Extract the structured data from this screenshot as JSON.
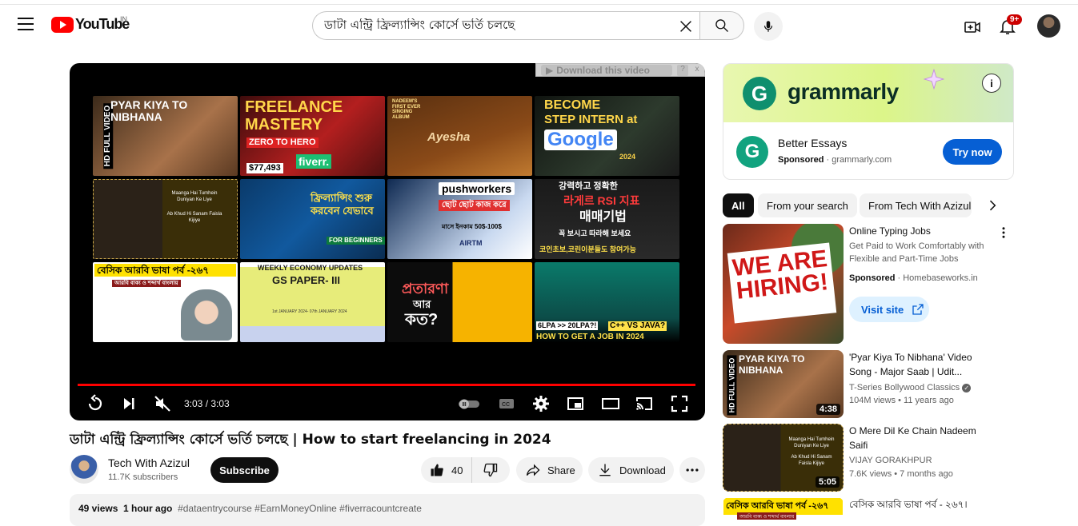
{
  "header": {
    "logo_text": "YouTube",
    "country": "IN",
    "search_value": "ডাটা এন্ট্রি ফ্রিল্যান্সিং কোর্সে ভর্তি চলছে",
    "notification_count": "9+"
  },
  "player": {
    "download_label": "Download this video",
    "download_help": "?",
    "download_close": "x",
    "time": "3:03 / 3:03",
    "end_screen": [
      {
        "line1": "PYAR KIYA TO",
        "line2": "NIBHANA",
        "side": "HD FULL VIDEO"
      },
      {
        "line1": "FREELANCE",
        "line2": "MASTERY",
        "line3": "ZERO TO HERO",
        "line4": "$77,493",
        "line5": "fiverr."
      },
      {
        "line1": "NADEEM'S FIRST EVER SINGING ALBUM",
        "line2": "Ayesha"
      },
      {
        "line1": "BECOME",
        "line2": "STEP INTERN at",
        "line3": "Google",
        "line4": "2024"
      },
      {
        "line1": "Maanga Hai Tumhein Duniyan Ke Liye",
        "line2": "Ab Khud Hi Sanam Faisla Kijiye"
      },
      {
        "line1": "ফ্রিল্যান্সিং শুরু করবেন যেভাবে",
        "line2": "FOR BEGINNERS"
      },
      {
        "line1": "pushworkers",
        "line2": "ছোট ছোট কাজ করে",
        "line3": "মাসে ইনকাম 50$-100$",
        "line4": "AIRTM"
      },
      {
        "line1": "강력하고 정확한",
        "line2": "라게르 RSI 지표",
        "line3": "매매기법",
        "line4": "꼭 보시고 따라해 보세요",
        "line5": "코인초보,코린이분들도 참여가능"
      },
      {
        "line1": "বেসিক আরবি ভাষা পর্ব -২৬৭",
        "line2": "আরবি বাক্য ও শব্দার্থ বাংলায়"
      },
      {
        "line1": "WEEKLY ECONOMY UPDATES",
        "line2": "GS PAPER- III",
        "line3": "1st JANUARY 2024- 07th JANUARY 2024"
      },
      {
        "line1": "প্রতারণা",
        "line2": "আর",
        "line3": "কত?"
      },
      {
        "line1": "6LPA >> 20LPA?!",
        "line2": "C++ VS JAVA?",
        "line3": "HOW TO GET A JOB IN 2024"
      }
    ]
  },
  "video": {
    "title": "ডাটা এন্ট্রি ফ্রিল্যান্সিং কোর্সে ভর্তি চলছে | How to start freelancing in 2024",
    "channel_name": "Tech With Azizul",
    "subscribers": "11.7K subscribers",
    "subscribe_label": "Subscribe",
    "like_count": "40",
    "share_label": "Share",
    "download_label": "Download",
    "views": "49 views",
    "posted": "1 hour ago",
    "tags": "#dataentrycourse #EarnMoneyOnline #fiverracountcreate"
  },
  "ad": {
    "brand": "grammarly",
    "info": "i",
    "title": "Better Essays",
    "sponsored": "Sponsored",
    "domain": "grammarly.com",
    "cta": "Try now"
  },
  "chips": [
    "All",
    "From your search",
    "From Tech With Azizul"
  ],
  "recommendations": [
    {
      "title": "Online Typing Jobs",
      "desc": "Get Paid to Work Comfortably with Flexible and Part-Time Jobs",
      "sponsored": "Sponsored",
      "domain": "Homebaseworks.in",
      "cta": "Visit site",
      "thumb_text": "WE ARE HIRING!"
    },
    {
      "title": "'Pyar Kiya To Nibhana' Video Song - Major Saab | Udit...",
      "channel": "T-Series Bollywood Classics",
      "meta": "104M views • 11 years ago",
      "duration": "4:38",
      "thumb_line1": "PYAR KIYA TO",
      "thumb_line2": "NIBHANA",
      "thumb_side": "HD FULL VIDEO"
    },
    {
      "title": "O Mere Dil Ke Chain Nadeem Saifi",
      "channel": "VIJAY GORAKHPUR",
      "meta": "7.6K views • 7 months ago",
      "duration": "5:05",
      "thumb_line1": "Maanga Hai Tumhein Duniyan Ke Liye",
      "thumb_line2": "Ab Khud Hi Sanam Faisla Kijiye"
    },
    {
      "title": "বেসিক আরবি ভাষা পর্ব - ২৬৭।",
      "thumb_line1": "বেসিক আরবি ভাষা পর্ব -২৬৭",
      "thumb_line2": "আরবি বাক্য ও শব্দার্থ বাংলায়"
    }
  ],
  "colors": {
    "brand_red": "#ff0000",
    "subscribe_bg": "#0f0f0f",
    "try_now_blue": "#065fd4",
    "grammarly_green": "#0f8f6e"
  }
}
